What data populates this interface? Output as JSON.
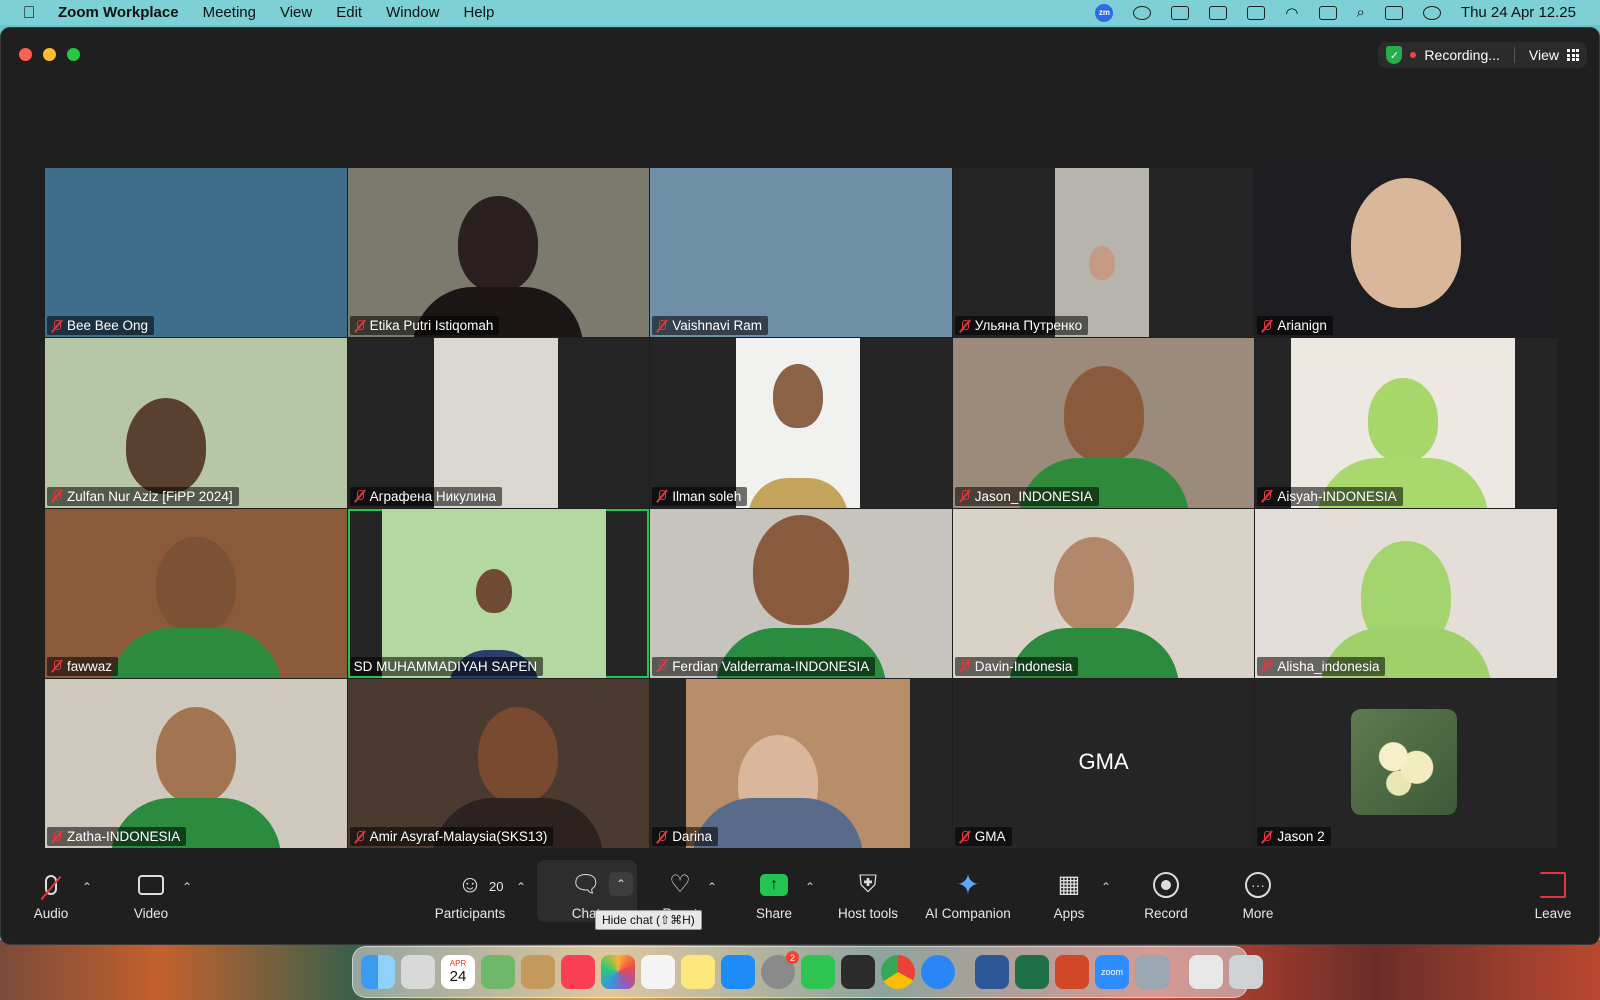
{
  "menubar": {
    "app_name": "Zoom Workplace",
    "items": [
      "Meeting",
      "View",
      "Edit",
      "Window",
      "Help"
    ],
    "clock": "Thu 24 Apr  12.25",
    "zoom_tray_label": "zm"
  },
  "window": {
    "recording_label": "Recording...",
    "view_label": "View"
  },
  "tiles": [
    {
      "name": "Bee Bee Ong",
      "muted": true,
      "bg": "#3f6e8c"
    },
    {
      "name": "Etika Putri Istiqomah",
      "muted": true,
      "bg": "#7b7a6c"
    },
    {
      "name": "Vaishnavi Ram",
      "muted": true,
      "bg": "#6f8fa6"
    },
    {
      "name": "Ульяна Путренко",
      "muted": true,
      "bg": "#b6b4ad"
    },
    {
      "name": "Arianign",
      "muted": true,
      "bg": "#1d1d22"
    },
    {
      "name": "Zulfan Nur Aziz [FiPP 2024]",
      "muted": true,
      "bg": "#b7c7a6"
    },
    {
      "name": "Аграфена Никулина",
      "muted": true,
      "bg": "#d9d7cf"
    },
    {
      "name": "Ilman soleh",
      "muted": true,
      "bg": "#f1f1ef"
    },
    {
      "name": "Jason_INDONESIA",
      "muted": true,
      "bg": "#9c8a7a"
    },
    {
      "name": "Aisyah-INDONESIA",
      "muted": true,
      "bg": "#ede9e2"
    },
    {
      "name": "fawwaz",
      "muted": true,
      "bg": "#8a5a3a"
    },
    {
      "name": "SD MUHAMMADIYAH SAPEN",
      "muted": false,
      "bg": "#b4d8a2"
    },
    {
      "name": "Ferdian Valderrama-INDONESIA",
      "muted": true,
      "bg": "#c7c4bd"
    },
    {
      "name": "Davin-Indonesia",
      "muted": true,
      "bg": "#d8d3c6"
    },
    {
      "name": "Alisha_indonesia",
      "muted": true,
      "bg": "#e3dfd8"
    },
    {
      "name": "Zatha-INDONESIA",
      "muted": true,
      "bg": "#cfc8bc"
    },
    {
      "name": "Amir Asyraf-Malaysia(SKS13)",
      "muted": true,
      "bg": "#4a3a30"
    },
    {
      "name": "Darina",
      "muted": true,
      "bg": "#b78d6a"
    },
    {
      "name": "GMA",
      "muted": true,
      "bg": "#252525",
      "display_text": "GMA"
    },
    {
      "name": "Jason 2",
      "muted": true,
      "bg": "#252525"
    }
  ],
  "toolbar": {
    "audio": "Audio",
    "video": "Video",
    "participants": "Participants",
    "participant_count": "20",
    "chat": "Chat",
    "chat_tooltip": "Hide chat (⇧⌘H)",
    "react": "React",
    "share": "Share",
    "host_tools": "Host tools",
    "ai_companion": "AI Companion",
    "apps": "Apps",
    "record": "Record",
    "more": "More",
    "leave": "Leave"
  },
  "dock": {
    "calendar_month": "APR",
    "calendar_day": "24",
    "settings_badge": "2",
    "zoom_label": "zoom"
  },
  "colors": {
    "accent_green": "#23c552",
    "mute_red": "#e0383e",
    "window_bg": "#1f1f1f"
  }
}
